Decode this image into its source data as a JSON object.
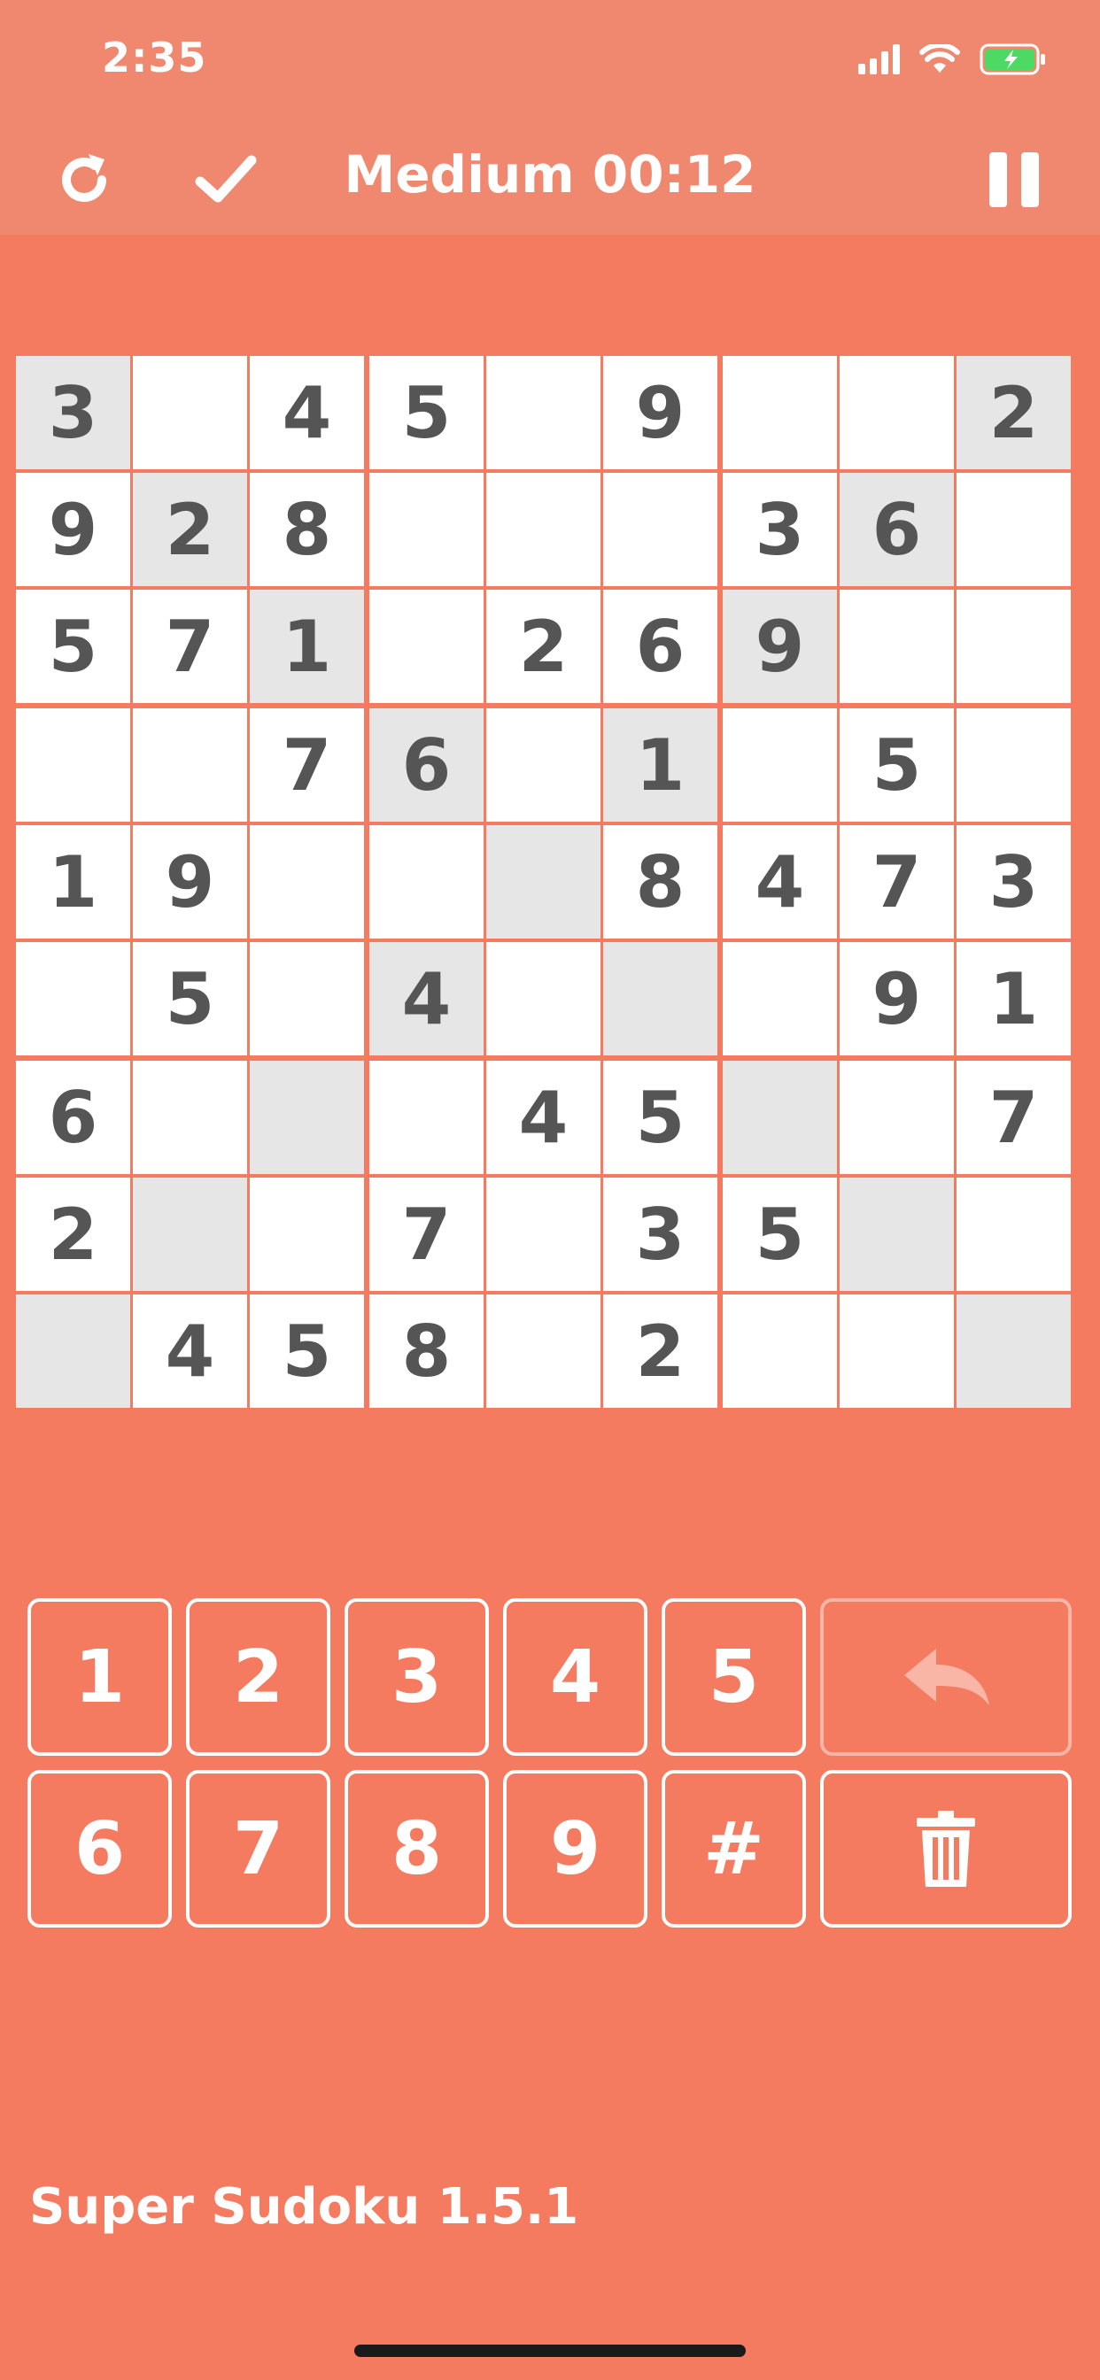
{
  "status_bar": {
    "time": "2:35"
  },
  "nav": {
    "title": "Medium 00:12",
    "restart_icon": "restart-icon",
    "check_icon": "checkmark-icon",
    "pause_icon": "pause-icon"
  },
  "grid": {
    "rows": [
      [
        "3",
        "",
        "4",
        "5",
        "",
        "9",
        "",
        "",
        "2"
      ],
      [
        "9",
        "2",
        "8",
        "",
        "",
        "",
        "3",
        "6",
        ""
      ],
      [
        "5",
        "7",
        "1",
        "",
        "2",
        "6",
        "9",
        "",
        ""
      ],
      [
        "",
        "",
        "7",
        "6",
        "",
        "1",
        "",
        "5",
        ""
      ],
      [
        "1",
        "9",
        "",
        "",
        "",
        "8",
        "4",
        "7",
        "3"
      ],
      [
        "",
        "5",
        "",
        "4",
        "",
        "",
        "",
        "9",
        "1"
      ],
      [
        "6",
        "",
        "",
        "",
        "4",
        "5",
        "",
        "",
        "7"
      ],
      [
        "2",
        "",
        "",
        "7",
        "",
        "3",
        "5",
        "",
        ""
      ],
      [
        "",
        "4",
        "5",
        "8",
        "",
        "2",
        "",
        "",
        ""
      ]
    ],
    "shaded": [
      [
        1,
        0,
        0,
        0,
        0,
        0,
        0,
        0,
        1
      ],
      [
        0,
        1,
        0,
        0,
        0,
        0,
        0,
        1,
        0
      ],
      [
        0,
        0,
        1,
        0,
        0,
        0,
        1,
        0,
        0
      ],
      [
        0,
        0,
        0,
        1,
        0,
        1,
        0,
        0,
        0
      ],
      [
        0,
        0,
        0,
        0,
        1,
        0,
        0,
        0,
        0
      ],
      [
        0,
        0,
        0,
        1,
        0,
        1,
        0,
        0,
        0
      ],
      [
        0,
        0,
        1,
        0,
        0,
        0,
        1,
        0,
        0
      ],
      [
        0,
        1,
        0,
        0,
        0,
        0,
        0,
        1,
        0
      ],
      [
        1,
        0,
        0,
        0,
        0,
        0,
        0,
        0,
        1
      ]
    ]
  },
  "keypad": {
    "row1": [
      "1",
      "2",
      "3",
      "4",
      "5"
    ],
    "row2": [
      "6",
      "7",
      "8",
      "9",
      "#"
    ],
    "undo_icon": "undo-icon",
    "delete_icon": "trash-icon"
  },
  "footer": {
    "version": "Super Sudoku 1.5.1"
  },
  "colors": {
    "background": "#F47A60",
    "header": "#F0876F",
    "cell": "#FFFFFF",
    "cell_shaded": "#E6E6E6",
    "digit": "#555555",
    "battery": "#4CD964"
  }
}
